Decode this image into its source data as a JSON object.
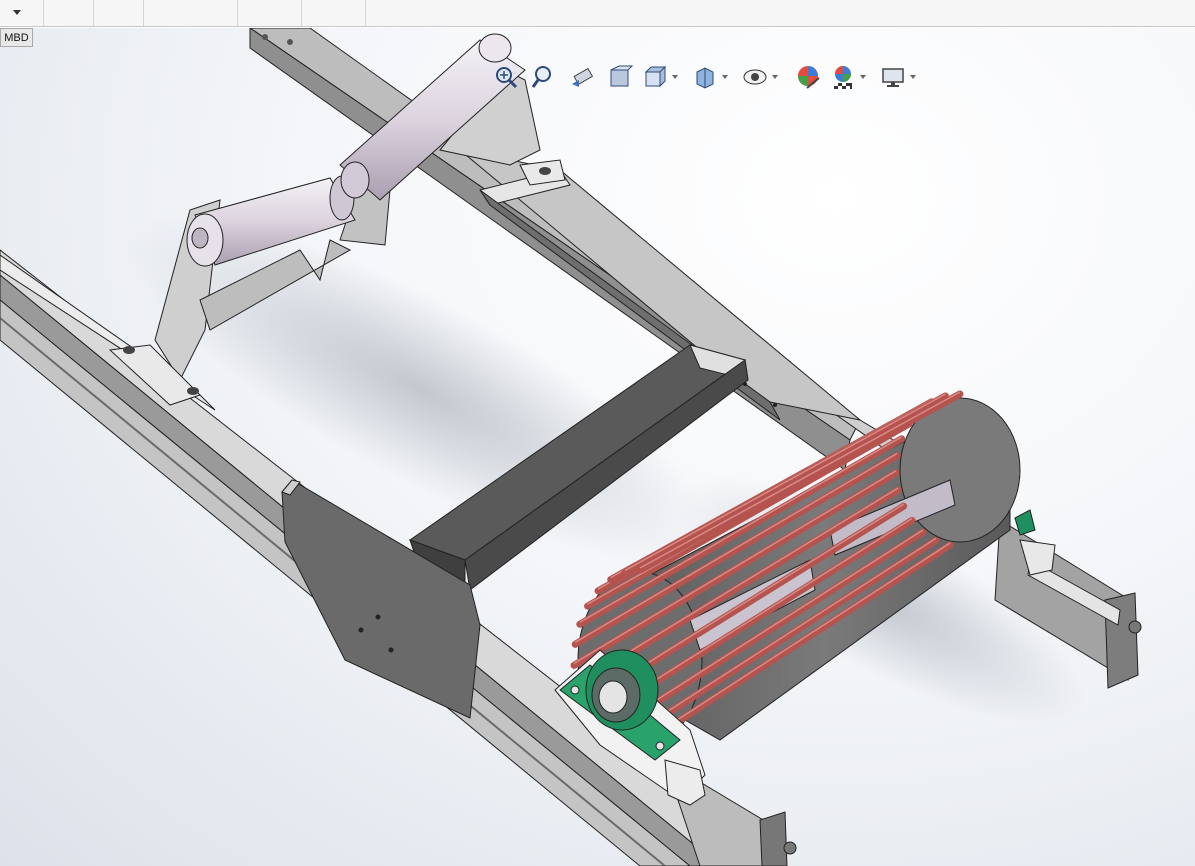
{
  "toolbar": {
    "mbd_tab": "MBD",
    "heads_up": [
      {
        "name": "zoom-to-fit-icon",
        "dropdown": false
      },
      {
        "name": "zoom-to-area-icon",
        "dropdown": false
      },
      {
        "name": "previous-view-icon",
        "dropdown": false
      },
      {
        "name": "section-view-icon",
        "dropdown": false
      },
      {
        "name": "view-orientation-icon",
        "dropdown": true
      },
      {
        "name": "display-style-icon",
        "dropdown": true
      },
      {
        "name": "hide-show-items-icon",
        "dropdown": true
      },
      {
        "name": "edit-appearance-icon",
        "dropdown": false
      },
      {
        "name": "apply-scene-icon",
        "dropdown": true
      },
      {
        "name": "view-settings-icon",
        "dropdown": true
      }
    ]
  },
  "colors": {
    "frame_steel": "#d3d3d3",
    "frame_dark": "#4f4f4f",
    "roller": "#d9d2de",
    "rod_red": "#b5534f",
    "bearing_green": "#1f8f5f",
    "background_top": "#ffffff",
    "background_bottom": "#dde2ea"
  }
}
